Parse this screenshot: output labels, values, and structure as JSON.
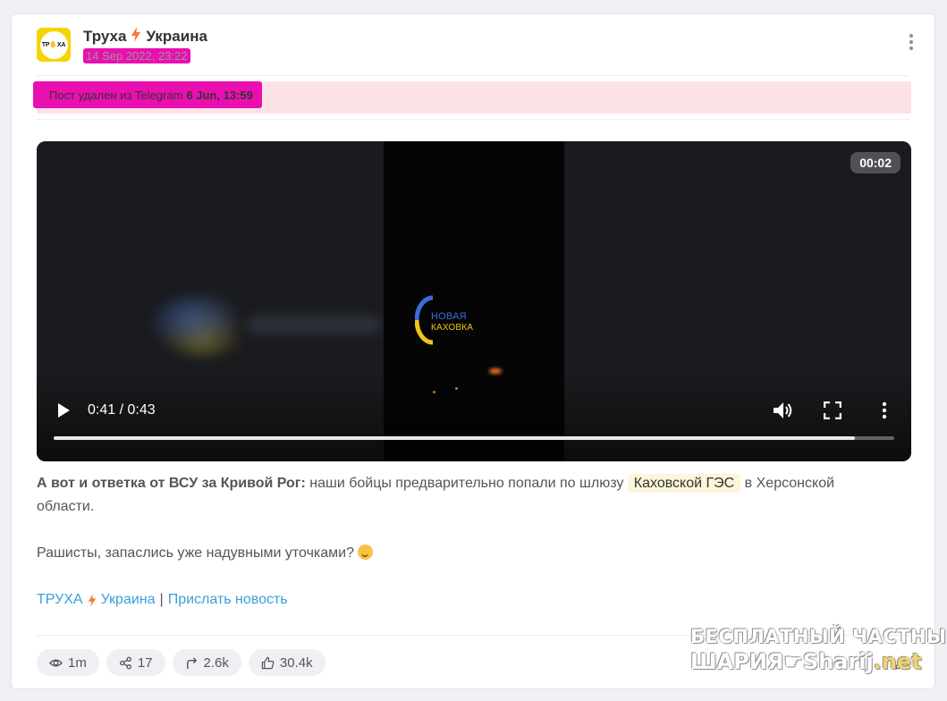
{
  "channel": {
    "name": "Труха",
    "name_suffix": "Украина",
    "avatar_text": "ТР✋ХА",
    "date": "14 Sep 2022, 23:22"
  },
  "deleted_notice": {
    "text": "Пост удален из Telegram",
    "date": "6 Jun, 13:59"
  },
  "video": {
    "duration_badge": "00:02",
    "time_display": "0:41 / 0:43",
    "progress_fraction": 0.953,
    "overlay_logo_line1": "НОВАЯ",
    "overlay_logo_line2": "КАХОВКА"
  },
  "post": {
    "bold_lead": "А вот и ответка от ВСУ за Кривой Рог:",
    "text_before_chip": " наши бойцы предварительно попали по шлюзу ",
    "chip": "Каховской ГЭС",
    "text_after_chip": " в Херсонской области.",
    "second_para": "Рашисты, запаслись уже надувными уточками?",
    "emoji_icon": "grimace-emoji-icon"
  },
  "links": {
    "channel_link_a": "ТРУХА",
    "channel_link_b": "Украина",
    "separator": "|",
    "submit_news": "Прислать новость"
  },
  "stats": {
    "views": "1m",
    "shares": "17",
    "forwards": "2.6k",
    "likes": "30.4k"
  },
  "watermark": {
    "line1": "БЕСПЛАТНЫЙ ЧАСТНЫЙ",
    "line2_a": "ШАРИЯ",
    "line2_b": "Sharij",
    "line2_c": ".net"
  },
  "colors": {
    "accent_link": "#3aa0d9",
    "bolt": "#f07d2c",
    "highlight_magenta": "#e90fb0",
    "deleted_bg": "#fde2e5",
    "avatar_bg": "#f5d400"
  }
}
